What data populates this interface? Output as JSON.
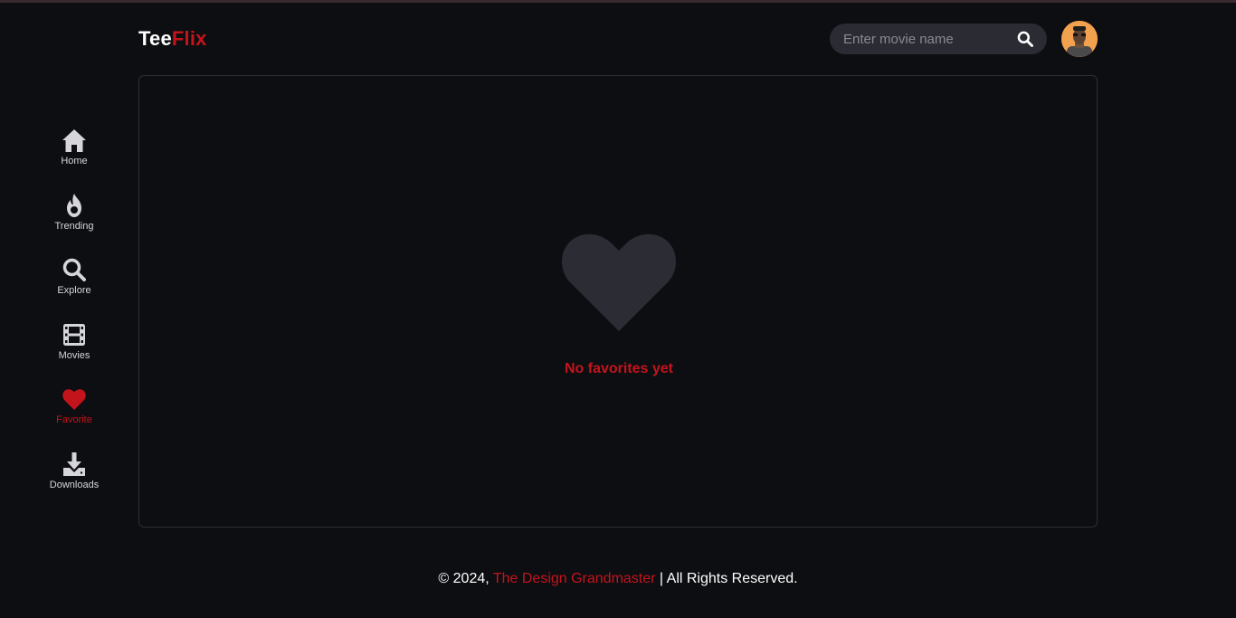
{
  "header": {
    "logo_part1": "Tee",
    "logo_part2": "Flix",
    "search_placeholder": "Enter movie name",
    "search_icon": "search-icon",
    "avatar": "user-avatar"
  },
  "sidebar": {
    "items": [
      {
        "label": "Home",
        "icon": "home-icon"
      },
      {
        "label": "Trending",
        "icon": "flame-icon"
      },
      {
        "label": "Explore",
        "icon": "search-icon"
      },
      {
        "label": "Movies",
        "icon": "film-icon"
      },
      {
        "label": "Favorite",
        "icon": "heart-icon",
        "active": true
      },
      {
        "label": "Downloads",
        "icon": "download-icon"
      }
    ]
  },
  "main": {
    "empty_icon": "heart-icon",
    "empty_message": "No favorites yet"
  },
  "footer": {
    "prefix": "© 2024, ",
    "brand": "The Design Grandmaster",
    "suffix": " | All Rights Reserved."
  },
  "colors": {
    "accent": "#c4141b",
    "background": "#0d0e12",
    "surface": "#2a2b33",
    "heart_muted": "#2b2c34"
  }
}
